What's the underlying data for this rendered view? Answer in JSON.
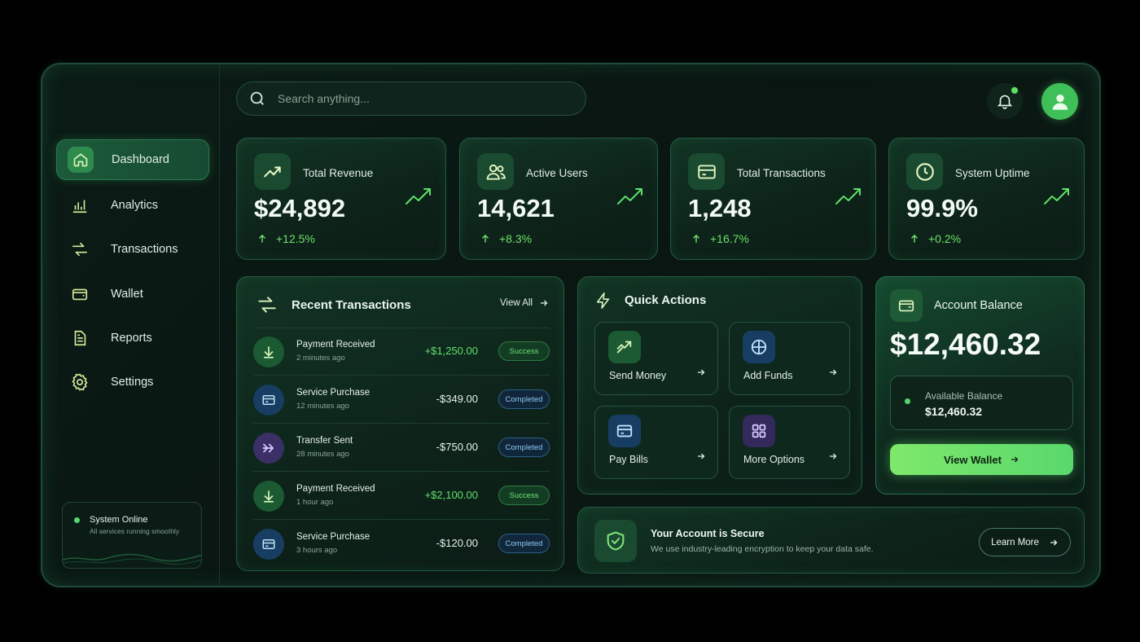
{
  "search": {
    "placeholder": "Search anything..."
  },
  "sidebar": {
    "items": [
      {
        "label": "Dashboard",
        "icon": "home-icon",
        "active": true
      },
      {
        "label": "Analytics",
        "icon": "bar-chart-icon"
      },
      {
        "label": "Transactions",
        "icon": "transfer-icon"
      },
      {
        "label": "Wallet",
        "icon": "wallet-icon"
      },
      {
        "label": "Reports",
        "icon": "document-icon"
      },
      {
        "label": "Settings",
        "icon": "gear-icon"
      }
    ],
    "status": {
      "title": "System Online",
      "subtitle": "All services running smoothly"
    }
  },
  "stats": [
    {
      "title": "Total Revenue",
      "value": "$24,892",
      "change": "+12.5%",
      "icon": "trending-up-icon"
    },
    {
      "title": "Active Users",
      "value": "14,621",
      "change": "+8.3%",
      "icon": "users-icon"
    },
    {
      "title": "Total Transactions",
      "value": "1,248",
      "change": "+16.7%",
      "icon": "card-icon"
    },
    {
      "title": "System Uptime",
      "value": "99.9%",
      "change": "+0.2%",
      "icon": "clock-icon"
    }
  ],
  "recent": {
    "title": "Recent Transactions",
    "view_all": "View All",
    "rows": [
      {
        "name": "Payment Received",
        "time": "2 minutes ago",
        "amount": "+$1,250.00",
        "status": "Success",
        "kind": "received"
      },
      {
        "name": "Service Purchase",
        "time": "12 minutes ago",
        "amount": "-$349.00",
        "status": "Completed",
        "kind": "purchase"
      },
      {
        "name": "Transfer Sent",
        "time": "28 minutes ago",
        "amount": "-$750.00",
        "status": "Completed",
        "kind": "transfer"
      },
      {
        "name": "Payment Received",
        "time": "1 hour ago",
        "amount": "+$2,100.00",
        "status": "Success",
        "kind": "received"
      },
      {
        "name": "Service Purchase",
        "time": "3 hours ago",
        "amount": "-$120.00",
        "status": "Completed",
        "kind": "purchase"
      }
    ]
  },
  "quick_actions": {
    "title": "Quick Actions",
    "items": [
      {
        "label": "Send Money",
        "icon": "send-icon"
      },
      {
        "label": "Add Funds",
        "icon": "plus-icon"
      },
      {
        "label": "Pay Bills",
        "icon": "bill-icon"
      },
      {
        "label": "More Options",
        "icon": "grid-icon"
      }
    ]
  },
  "balance": {
    "title": "Account Balance",
    "amount": "$12,460.32",
    "available_label": "Available Balance",
    "available_value": "$12,460.32",
    "button": "View Wallet"
  },
  "security": {
    "title": "Your Account is Secure",
    "subtitle": "We use industry-leading encryption to keep your data safe.",
    "button": "Learn More"
  },
  "colors": {
    "accent": "#5ee06a",
    "background": "#0a1612",
    "completed_blue": "#8fc6f0"
  }
}
